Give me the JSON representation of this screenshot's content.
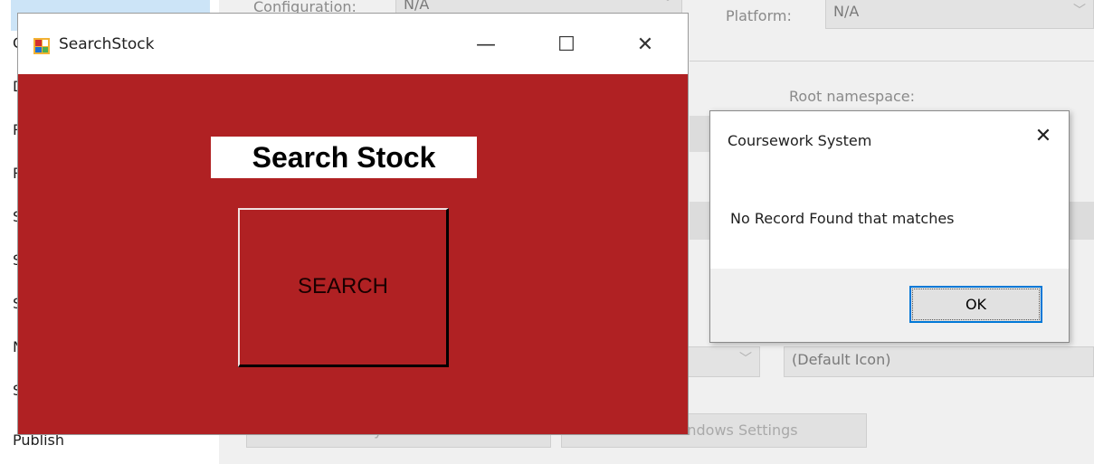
{
  "background": {
    "sidebar_letters": [
      "C",
      "D",
      "R",
      "R",
      "S",
      "S",
      "S",
      "N",
      "S"
    ],
    "sidebar_publish": "Publish",
    "configuration_label": "Configuration:",
    "configuration_value": "N/A",
    "platform_label": "Platform:",
    "platform_value": "N/A",
    "root_namespace_label": "Root namespace:",
    "icon_value": "(Default Icon)",
    "assembly_button": "Assembly Information...",
    "view_windows_button": "View Windows Settings"
  },
  "window": {
    "title": "SearchStock",
    "minimize_glyph": "—",
    "maximize_glyph": "☐",
    "close_glyph": "✕",
    "heading": "Search Stock",
    "search_button": "SEARCH"
  },
  "dialog": {
    "title": "Coursework System",
    "close_glyph": "✕",
    "message": "No Record Found that matches",
    "ok_button": "OK"
  },
  "colors": {
    "window_background": "#b02123",
    "dialog_accent": "#0078d7"
  }
}
